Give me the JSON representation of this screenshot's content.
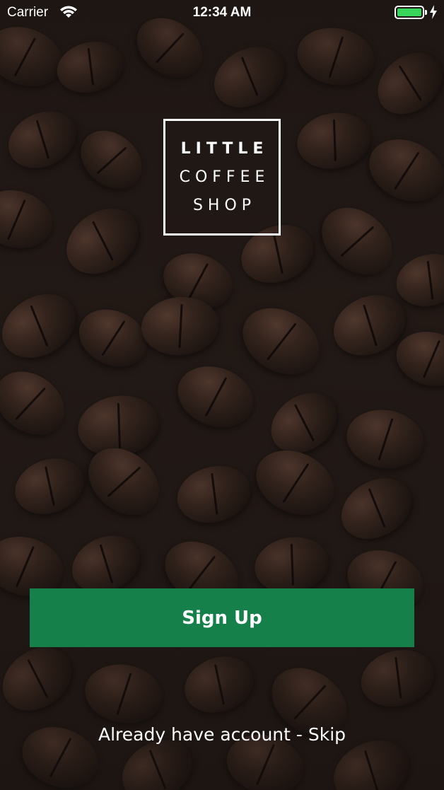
{
  "status_bar": {
    "carrier": "Carrier",
    "time": "12:34 AM",
    "battery_color": "#37d65a"
  },
  "logo": {
    "line1": "LITTLE",
    "line2": "COFFEE",
    "line3": "SHOP"
  },
  "actions": {
    "signup_label": "Sign Up",
    "signup_color": "#16804a",
    "skip_label": "Already have account - Skip"
  },
  "background": {
    "description_icon": "coffee-beans-background"
  }
}
